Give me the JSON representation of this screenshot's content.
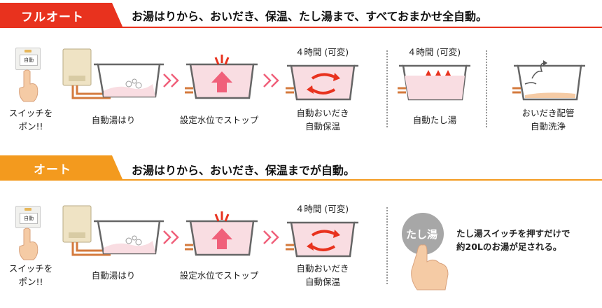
{
  "full_auto": {
    "tab_label": "フルオート",
    "headline": "お湯はりから、おいだき、保温、たし湯まで、すべておまかせ全自動。",
    "switch_button": "自動",
    "switch_caption": [
      "スイッチを",
      "ポン!!"
    ],
    "step_fill": "自動湯はり",
    "step_stop": "設定水位でストップ",
    "timer_reheat": "４時間 (可変)",
    "step_reheat": [
      "自動おいだき",
      "自動保温"
    ],
    "timer_topup": "４時間 (可変)",
    "step_topup": "自動たし湯",
    "step_clean": [
      "おいだき配管",
      "自動洗浄"
    ]
  },
  "auto": {
    "tab_label": "オート",
    "headline": "お湯はりから、おいだき、保温までが自動。",
    "switch_button": "自動",
    "switch_caption": [
      "スイッチを",
      "ポン!!"
    ],
    "step_fill": "自動湯はり",
    "step_stop": "設定水位でストップ",
    "timer_reheat": "４時間 (可変)",
    "step_reheat": [
      "自動おいだき",
      "自動保温"
    ],
    "topup_button": "たし湯",
    "topup_note": [
      "たし湯スイッチを押すだけで",
      "約20Lのお湯が足される。"
    ]
  },
  "colors": {
    "tab_red": "#e8321e",
    "tab_orange": "#f39a1e",
    "arrow_pink": "#f0607a",
    "water_pink": "#f9dde2",
    "heater_beige": "#efe3c4"
  }
}
